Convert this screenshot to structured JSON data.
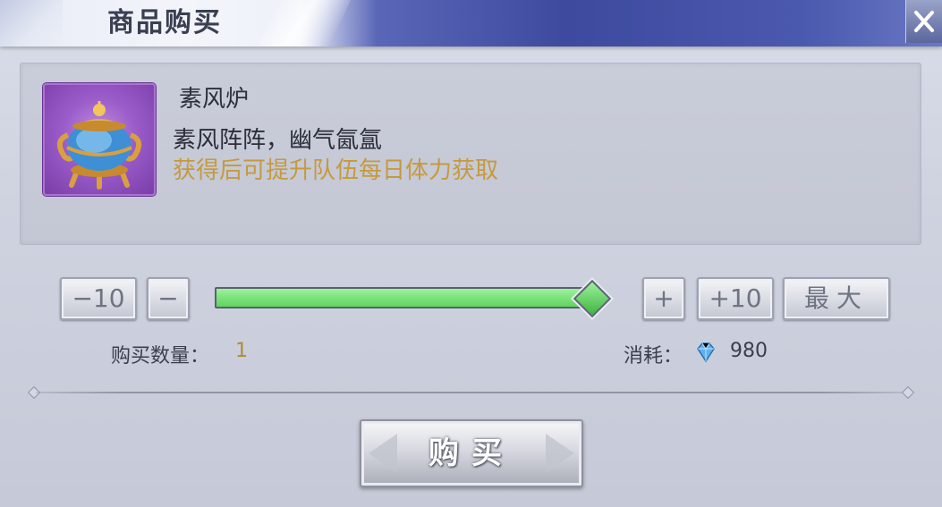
{
  "header": {
    "title": "商品购买"
  },
  "item": {
    "name": "素风炉",
    "description": "素风阵阵，幽气氤氲",
    "effect": "获得后可提升队伍每日体力获取",
    "icon": "censer-icon"
  },
  "controls": {
    "minus10_label": "−10",
    "minus_label": "−",
    "plus_label": "+",
    "plus10_label": "+10",
    "max_label": "最大",
    "slider_fraction": 1.0
  },
  "purchase": {
    "quantity_label": "购买数量：",
    "quantity_value": "1",
    "cost_label": "消耗：",
    "cost_icon": "diamond-icon",
    "cost_value": "980"
  },
  "buy_button": {
    "label": "购买"
  },
  "colors": {
    "slider": "#7be37b",
    "effect_text": "#c59a3e",
    "quantity_value": "#b38a36",
    "item_bg": "#9a5cc9"
  }
}
